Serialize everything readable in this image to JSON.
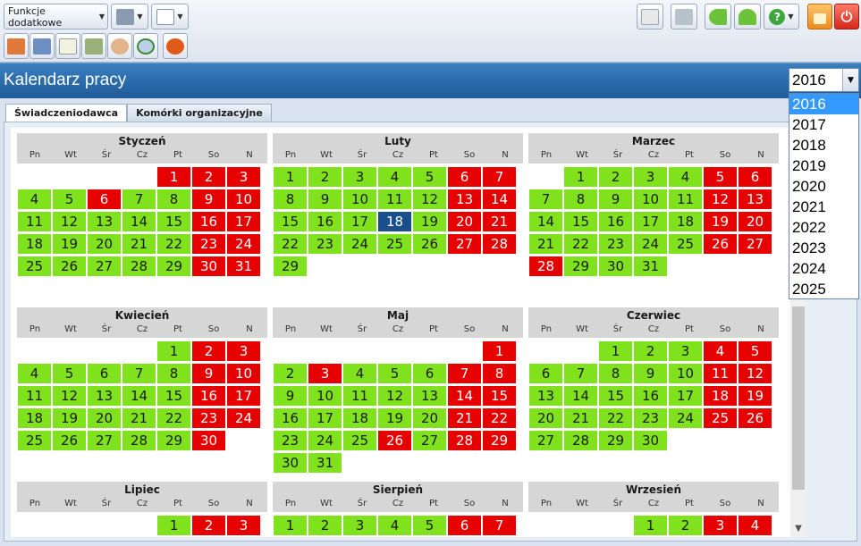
{
  "toolbar": {
    "extra_functions_label": "Funkcje dodatkowe",
    "icons": [
      "printer-icon",
      "layout-icon",
      "mail-icon",
      "network-icon",
      "back-arrow-icon",
      "up-arrow-icon",
      "help-icon",
      "lock-icon",
      "power-icon",
      "home-icon",
      "calendar-list-icon",
      "notepad-icon",
      "documents-icon",
      "people-icon",
      "clock-refresh-icon",
      "settings-flower-icon"
    ]
  },
  "header": {
    "title": "Kalendarz pracy"
  },
  "year_select": {
    "value": "2016",
    "options": [
      "2016",
      "2017",
      "2018",
      "2019",
      "2020",
      "2021",
      "2022",
      "2023",
      "2024",
      "2025"
    ]
  },
  "tabs": [
    {
      "label": "Świadczeniodawca"
    },
    {
      "label": "Komórki organizacyjne"
    }
  ],
  "weekdays": [
    "Pn",
    "Wt",
    "Śr",
    "Cz",
    "Pt",
    "So",
    "N"
  ],
  "colors": {
    "workday": "#80e21c",
    "holiday": "#e60000",
    "today": "#1a4f8c",
    "header": "#d6d6d6",
    "title_bar": "#1f5a98"
  },
  "months": [
    {
      "name": "Styczeń",
      "start": 4,
      "days": 31,
      "holidays": [
        1,
        2,
        3,
        6,
        9,
        10,
        16,
        17,
        23,
        24,
        30,
        31
      ],
      "today": null
    },
    {
      "name": "Luty",
      "start": 0,
      "days": 29,
      "holidays": [
        6,
        7,
        13,
        14,
        20,
        21,
        27,
        28
      ],
      "today": 18
    },
    {
      "name": "Marzec",
      "start": 1,
      "days": 31,
      "holidays": [
        5,
        6,
        12,
        13,
        19,
        20,
        26,
        27,
        28
      ],
      "today": null
    },
    {
      "name": "Kwiecień",
      "start": 4,
      "days": 30,
      "holidays": [
        2,
        3,
        9,
        10,
        16,
        17,
        23,
        24,
        30
      ],
      "today": null
    },
    {
      "name": "Maj",
      "start": 6,
      "days": 31,
      "holidays": [
        1,
        3,
        7,
        8,
        14,
        15,
        21,
        22,
        26,
        28,
        29
      ],
      "today": null
    },
    {
      "name": "Czerwiec",
      "start": 2,
      "days": 30,
      "holidays": [
        4,
        5,
        11,
        12,
        18,
        19,
        25,
        26
      ],
      "today": null
    },
    {
      "name": "Lipiec",
      "start": 4,
      "days": 3,
      "holidays": [
        2,
        3
      ],
      "today": null
    },
    {
      "name": "Sierpień",
      "start": 0,
      "days": 7,
      "holidays": [
        6,
        7
      ],
      "today": null
    },
    {
      "name": "Wrzesień",
      "start": 3,
      "days": 4,
      "holidays": [
        3,
        4
      ],
      "today": null
    }
  ]
}
